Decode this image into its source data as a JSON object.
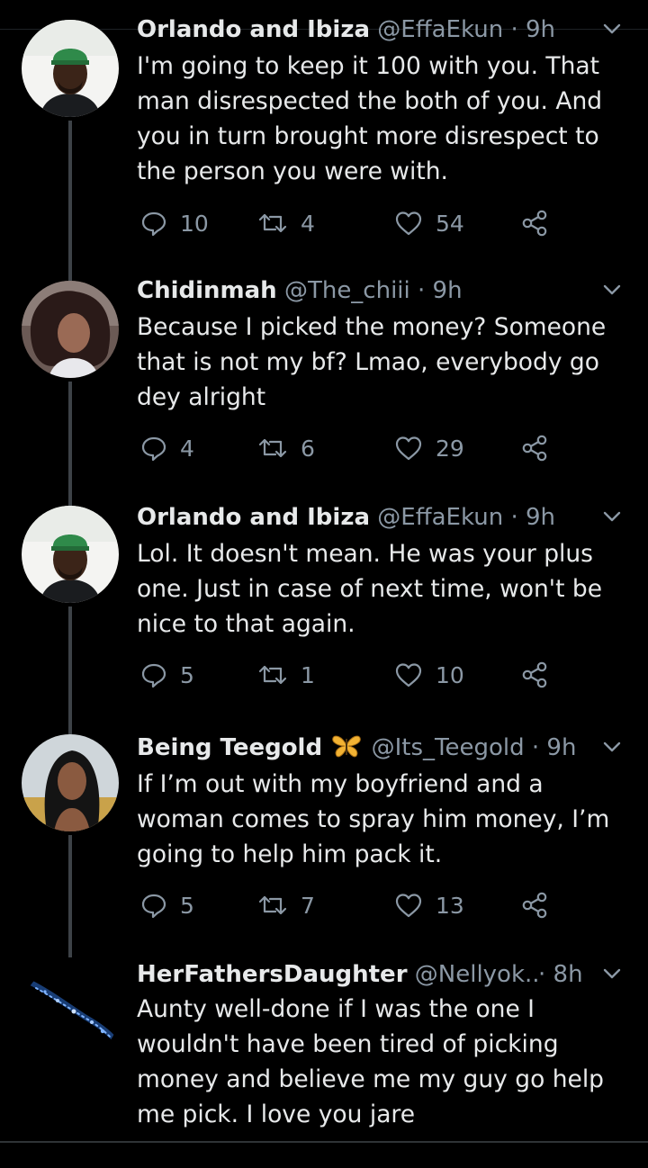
{
  "colors": {
    "background": "#000000",
    "text_primary": "#e7e9ea",
    "text_secondary": "#8b98a5",
    "thread_line": "#3d4247"
  },
  "tweets": [
    {
      "name": "Orlando and Ibiza",
      "handle": "@EffaEkun",
      "time": "· 9h",
      "text": "I'm going to keep it 100 with you. That\nman disrespected the both of you. And\nyou in turn brought more disrespect to\nthe person you were with.",
      "replies": "10",
      "retweets": "4",
      "likes": "54",
      "avatar_icon": "avatar-man-green-cap"
    },
    {
      "name": "Chidinmah",
      "handle": "@The_chiii",
      "time": "· 9h",
      "text": "Because I picked the money? Someone\nthat is not my bf? Lmao, everybody go\ndey alright",
      "replies": "4",
      "retweets": "6",
      "likes": "29",
      "avatar_icon": "avatar-woman"
    },
    {
      "name": "Orlando and Ibiza",
      "handle": "@EffaEkun",
      "time": "· 9h",
      "text": "Lol. It doesn't mean. He was your plus\none. Just in case of next time, won't be\nnice to that again.",
      "replies": "5",
      "retweets": "1",
      "likes": "10",
      "avatar_icon": "avatar-man-green-cap"
    },
    {
      "name": "Being Teegold",
      "name_emoji": "🦋",
      "handle": "@Its_Teegold",
      "time": "· 9h",
      "text": "If I’m out with my boyfriend and a\nwoman comes to spray him money, I’m\ngoing to help him pack it.",
      "replies": "5",
      "retweets": "7",
      "likes": "13",
      "avatar_icon": "avatar-woman-long-hair"
    },
    {
      "name": "HerFathersDaughter",
      "handle": "@Nellyok...",
      "time": "· 8h",
      "text": "Aunty well-done if I was the one I\nwouldn't have been tired of picking\nmoney and believe me my guy go help\nme pick. I love you jare",
      "avatar_icon": "avatar-blue-sparkle"
    }
  ]
}
